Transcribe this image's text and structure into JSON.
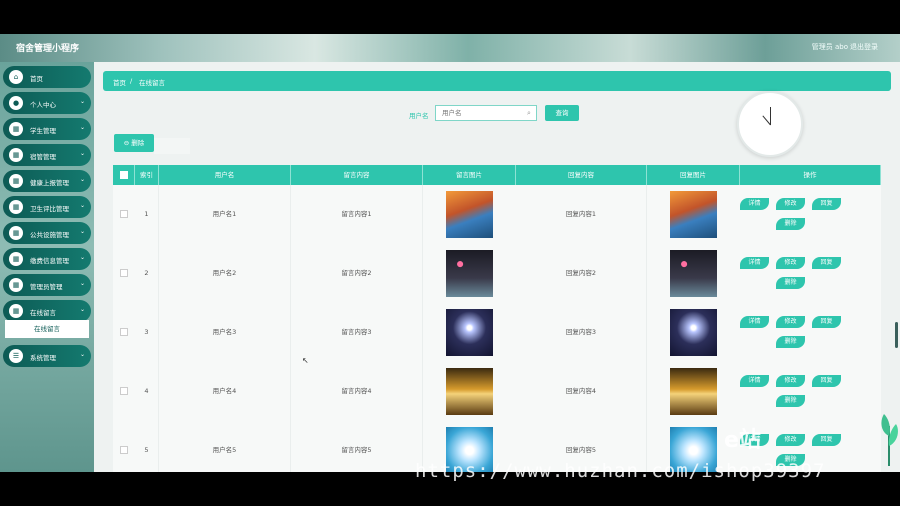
{
  "header": {
    "app_title": "宿舍管理小程序",
    "admin_label": "管理员 abo",
    "logout": "退出登录"
  },
  "sidebar": {
    "items": [
      {
        "label": "首页",
        "icon": "home-icon",
        "glyph": "⌂",
        "chevron": false
      },
      {
        "label": "个人中心",
        "icon": "user-icon",
        "glyph": "●",
        "chevron": true
      },
      {
        "label": "学生管理",
        "icon": "grid-icon",
        "glyph": "▦",
        "chevron": true
      },
      {
        "label": "宿管管理",
        "icon": "grid-icon",
        "glyph": "▦",
        "chevron": true
      },
      {
        "label": "健康上报管理",
        "icon": "grid-icon",
        "glyph": "▦",
        "chevron": true
      },
      {
        "label": "卫生评比管理",
        "icon": "grid-icon",
        "glyph": "▦",
        "chevron": true
      },
      {
        "label": "公共设施管理",
        "icon": "grid-icon",
        "glyph": "▦",
        "chevron": true
      },
      {
        "label": "缴费信息管理",
        "icon": "grid-icon",
        "glyph": "▦",
        "chevron": true
      },
      {
        "label": "管理员管理",
        "icon": "grid-icon",
        "glyph": "▦",
        "chevron": true
      },
      {
        "label": "在线留言",
        "icon": "grid-icon",
        "glyph": "▦",
        "chevron": true
      },
      {
        "label": "系统管理",
        "icon": "settings-icon",
        "glyph": "☰",
        "chevron": true
      }
    ],
    "active_sub": "在线留言"
  },
  "breadcrumb": {
    "home": "首页",
    "sep": "/",
    "current": "在线留言"
  },
  "search": {
    "label": "用户名",
    "placeholder": "用户名",
    "button": "查询"
  },
  "toolbar": {
    "delete": "⊖ 删除"
  },
  "table": {
    "headers": [
      "",
      "索引",
      "用户名",
      "留言内容",
      "留言图片",
      "回复内容",
      "回复图片",
      "操作"
    ],
    "actions": [
      "详情",
      "修改",
      "回复",
      "删除"
    ],
    "rows": [
      {
        "index": "1",
        "username": "用户名1",
        "message": "留言内容1",
        "reply": "回复内容1",
        "img": "autumn"
      },
      {
        "index": "2",
        "username": "用户名2",
        "message": "留言内容2",
        "reply": "回复内容2",
        "img": "night"
      },
      {
        "index": "3",
        "username": "用户名3",
        "message": "留言内容3",
        "reply": "回复内容3",
        "img": "star"
      },
      {
        "index": "4",
        "username": "用户名4",
        "message": "留言内容4",
        "reply": "回复内容4",
        "img": "sunset"
      },
      {
        "index": "5",
        "username": "用户名5",
        "message": "留言内容5",
        "reply": "回复内容5",
        "img": "flower"
      }
    ]
  },
  "watermark": {
    "url": "https://www.huzhan.com/ishop39397",
    "logo": "e站"
  },
  "colors": {
    "accent": "#2ec5ad",
    "sidebar_item": "#0d5b55"
  }
}
